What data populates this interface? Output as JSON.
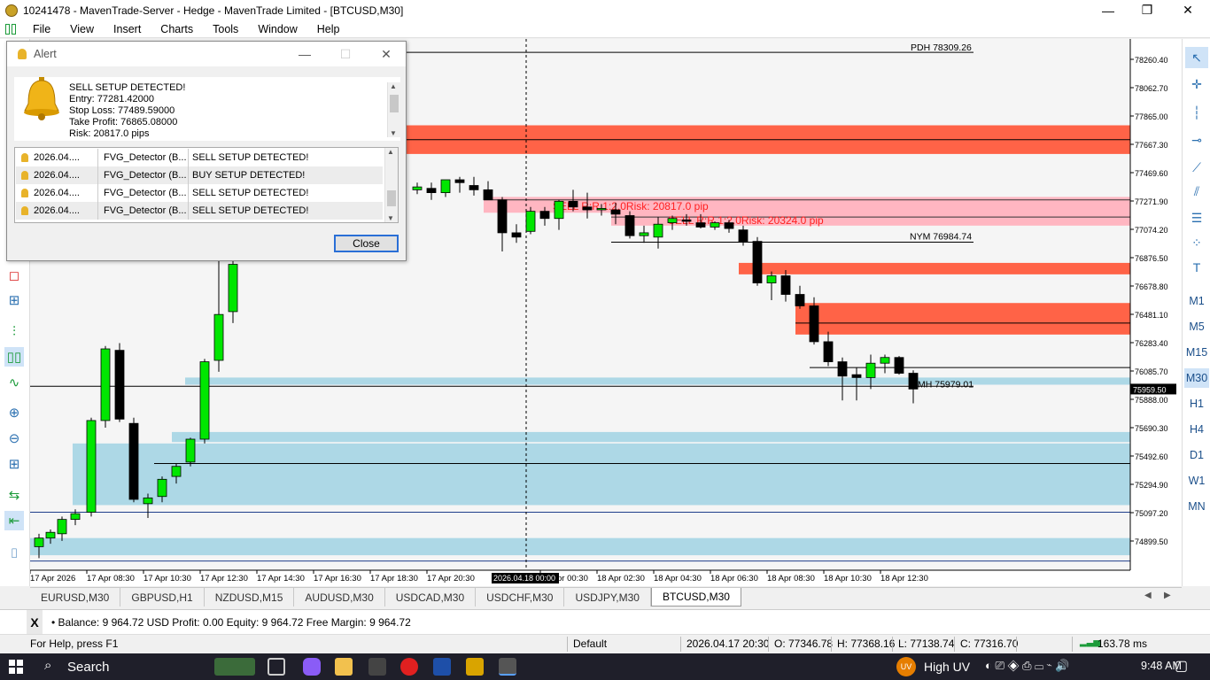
{
  "window": {
    "title": "10241478 - MavenTrade-Server - Hedge - MavenTrade Limited - [BTCUSD,M30]",
    "minimize": "—",
    "maximize": "❐",
    "close": "✕"
  },
  "menu": [
    "File",
    "View",
    "Insert",
    "Charts",
    "Tools",
    "Window",
    "Help"
  ],
  "right_toolbar": {
    "timeframes": [
      "M1",
      "M5",
      "M15",
      "M30",
      "H1",
      "H4",
      "D1",
      "W1",
      "MN"
    ],
    "active_timeframe": "M30"
  },
  "chart": {
    "symbol": "BTCUSD",
    "timeframe": "M30",
    "price_axis_labels": [
      "78260.40",
      "78062.70",
      "77865.00",
      "77667.30",
      "77469.60",
      "77271.90",
      "77074.20",
      "76876.50",
      "76678.80",
      "76481.10",
      "76283.40",
      "76085.70",
      "75888.00",
      "75690.30",
      "75492.60",
      "75294.90",
      "75097.20",
      "74899.50"
    ],
    "current_price": "75959.50",
    "time_axis_labels": [
      "17 Apr 2026",
      "17 Apr 08:30",
      "17 Apr 10:30",
      "17 Apr 12:30",
      "17 Apr 14:30",
      "17 Apr 16:30",
      "17 Apr 18:30",
      "17 Apr 20:30",
      "18 Apr 00:30",
      "18 Apr 02:30",
      "18 Apr 04:30",
      "18 Apr 06:30",
      "18 Apr 08:30",
      "18 Apr 10:30",
      "18 Apr 12:30"
    ],
    "crosshair_time": "2026.04.18 00:00",
    "level_labels": {
      "pdh": "PDH 78309.26",
      "nym": "NYM 76984.74",
      "pmh": "PMH 75979.01"
    },
    "trade_labels": [
      "SELL R:R 1:2.0Risk: 20817.0 pip",
      "SELL R:R 1:2.0Risk: 20324.0 pip"
    ],
    "colors": {
      "bull_candle": "#00e600",
      "bear_candle": "#000000",
      "supply_zone": "#ff6347",
      "demand_zone": "#add8e6",
      "trade_zone": "#ffb6c1",
      "trade_label": "#ff2020",
      "current_price_bg": "#000000"
    }
  },
  "alert": {
    "title": "Alert",
    "message_lines": [
      "SELL SETUP DETECTED!",
      "Entry: 77281.42000",
      "Stop Loss: 77489.59000",
      "Take Profit: 76865.08000",
      "Risk: 20817.0 pips"
    ],
    "rows": [
      {
        "time": "2026.04....",
        "expert": "FVG_Detector (B...",
        "message": "SELL SETUP DETECTED!"
      },
      {
        "time": "2026.04....",
        "expert": "FVG_Detector (B...",
        "message": "BUY SETUP DETECTED!"
      },
      {
        "time": "2026.04....",
        "expert": "FVG_Detector (B...",
        "message": "SELL SETUP DETECTED!"
      },
      {
        "time": "2026.04....",
        "expert": "FVG_Detector (B...",
        "message": "SELL SETUP DETECTED!"
      }
    ],
    "close_label": "Close"
  },
  "symbol_tabs": [
    "EURUSD,M30",
    "GBPUSD,H1",
    "NZDUSD,M15",
    "AUDUSD,M30",
    "USDCAD,M30",
    "USDCHF,M30",
    "USDJPY,M30",
    "BTCUSD,M30"
  ],
  "active_tab": "BTCUSD,M30",
  "terminal": {
    "close": "X",
    "account_line": "• Balance: 9 964.72 USD  Profit: 0.00  Equity: 9 964.72  Free Margin: 9 964.72"
  },
  "statusbar": {
    "help": "For Help, press F1",
    "profile": "Default",
    "datetime": "2026.04.17 20:30",
    "open": "O: 77346.78",
    "high": "H: 77368.16",
    "low": "L: 77138.74",
    "close": "C: 77316.70",
    "ping": "163.78 ms"
  },
  "taskbar": {
    "search": "Search",
    "uv_badge": "UV",
    "uv_text": "High UV",
    "time": "9:48 AM"
  }
}
